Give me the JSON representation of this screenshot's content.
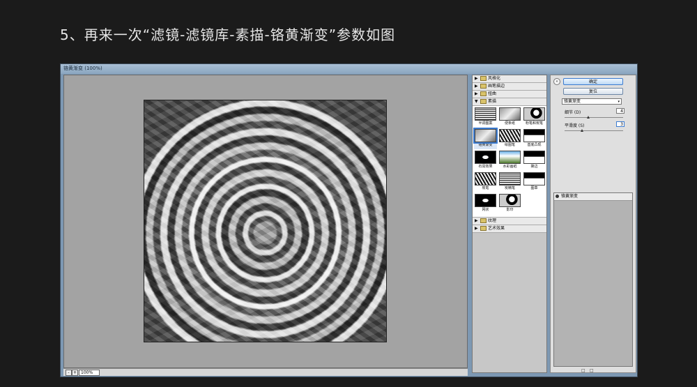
{
  "heading": "5、再来一次“滤镜-滤镜库-素描-铬黄渐变”参数如图",
  "window": {
    "title": "铬黄渐变 (100%)"
  },
  "zoom": {
    "minus": "-",
    "plus": "+",
    "value": "100%"
  },
  "categories": {
    "before": [
      "风格化",
      "画笔描边",
      "扭曲"
    ],
    "open": "素描",
    "after": [
      "纹理",
      "艺术效果"
    ]
  },
  "sketch_filters": [
    "半调图案",
    "便条纸",
    "粉笔和炭笔",
    "铬黄渐变",
    "绘图笔",
    "基底凸现",
    "石膏效果",
    "水彩画纸",
    "撕边",
    "炭笔",
    "炭精笔",
    "图章",
    "网状",
    "影印"
  ],
  "selected_filter": "铬黄渐变",
  "buttons": {
    "ok": "确定",
    "reset": "复位"
  },
  "filter_select": "铬黄渐变",
  "params": [
    {
      "label": "细节 (D)",
      "value": "4",
      "level": 0.4
    },
    {
      "label": "平滑度 (S)",
      "value": "3",
      "level": 0.3
    }
  ],
  "layers": {
    "item": "铬黄渐变"
  },
  "icons": {
    "category_open": "▼",
    "category_closed": "▶",
    "dropdown": "▾",
    "collapse": "«"
  }
}
